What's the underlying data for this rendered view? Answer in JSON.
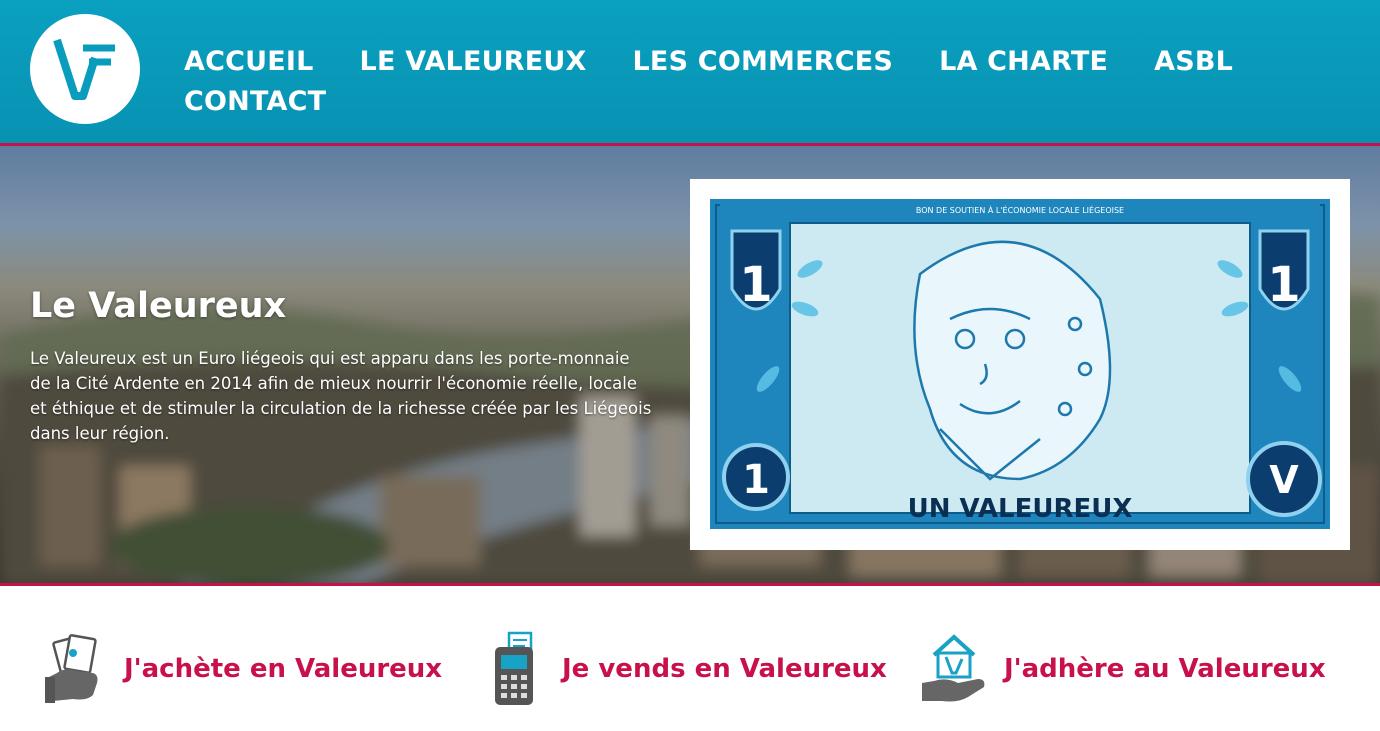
{
  "header": {
    "logo_text": "V",
    "nav": [
      {
        "label": "ACCUEIL"
      },
      {
        "label": "LE VALEUREUX"
      },
      {
        "label": "LES COMMERCES"
      },
      {
        "label": "LA CHARTE"
      },
      {
        "label": "ASBL"
      },
      {
        "label": "CONTACT"
      }
    ]
  },
  "hero": {
    "title": "Le Valeureux",
    "text": "Le Valeureux est un Euro liégeois qui est apparu dans les porte-monnaie de la Cité Ardente en 2014 afin de mieux nourrir l'économie réelle, locale et éthique et de stimuler la circulation de la richesse créée par les Liégeois dans leur région.",
    "banknote": {
      "top_text": "BON DE SOUTIEN À L'ÉCONOMIE LOCALE LIÉGEOISE",
      "denomination": "1",
      "name": "UN VALEUREUX",
      "seal_text": "V"
    }
  },
  "actions": [
    {
      "label": "J'achète en Valeureux",
      "icon": "money-hand-icon"
    },
    {
      "label": "Je vends en Valeureux",
      "icon": "payment-terminal-icon"
    },
    {
      "label": "J'adhère au Valeureux",
      "icon": "house-hand-icon"
    }
  ],
  "colors": {
    "header_bg": "#0a9cbd",
    "accent": "#c8104a",
    "banknote_blue": "#1a7fb5"
  }
}
